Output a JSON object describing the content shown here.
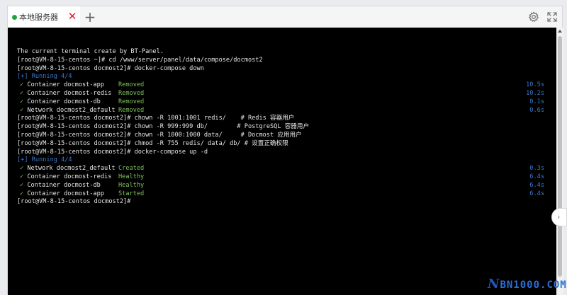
{
  "tab": {
    "label": "本地服务器",
    "close_symbol": "✕",
    "new_tab_symbol": "+"
  },
  "icons": {
    "status": "status-dot-icon",
    "close": "close-icon",
    "new_tab": "plus-icon",
    "settings": "gear-icon",
    "fullscreen": "fullscreen-icon"
  },
  "colors": {
    "terminal_bg": "#000000",
    "text": "#e6e6e6",
    "blue": "#3b78c8",
    "green": "#7fc35a",
    "status_dot": "#20a53a",
    "close": "#e0202a"
  },
  "terminal": {
    "welcome": "The current terminal create by BT-Panel.",
    "cmd1": "[root@VM-8-15-centos ~]# cd /www/server/panel/data/compose/docmost2",
    "cmd2": "[root@VM-8-15-centos docmost2]# docker-compose down",
    "running1": "[+] Running 4/4",
    "down_rows": [
      {
        "check": "✓",
        "name": "Container docmost-app",
        "status": "Removed",
        "time": "10.5s"
      },
      {
        "check": "✓",
        "name": "Container docmost-redis",
        "status": "Removed",
        "time": "10.2s"
      },
      {
        "check": "✓",
        "name": "Container docmost-db",
        "status": "Removed",
        "time": "0.1s"
      },
      {
        "check": "✓",
        "name": "Network docmost2_default",
        "status": "Removed",
        "time": "0.6s"
      }
    ],
    "cmd3": "[root@VM-8-15-centos docmost2]# chown -R 1001:1001 redis/    # Redis 容器用户",
    "cmd4": "[root@VM-8-15-centos docmost2]# chown -R 999:999 db/        # PostgreSQL 容器用户",
    "cmd5": "[root@VM-8-15-centos docmost2]# chown -R 1000:1000 data/     # Docmost 应用用户",
    "cmd6": "[root@VM-8-15-centos docmost2]# chmod -R 755 redis/ data/ db/ # 设置正确权限",
    "cmd7": "[root@VM-8-15-centos docmost2]# docker-compose up -d",
    "running2": "[+] Running 4/4",
    "up_rows": [
      {
        "check": "✓",
        "name": "Network docmost2_default",
        "status": "Created",
        "time": "0.3s"
      },
      {
        "check": "✓",
        "name": "Container docmost-redis",
        "status": "Healthy",
        "time": "6.4s"
      },
      {
        "check": "✓",
        "name": "Container docmost-db",
        "status": "Healthy",
        "time": "6.4s"
      },
      {
        "check": "✓",
        "name": "Container docmost-app",
        "status": "Started",
        "time": "6.4s"
      }
    ],
    "prompt": "[root@VM-8-15-centos docmost2]#"
  },
  "side_handle_symbol": "›",
  "watermark": {
    "prefix": "N",
    "rest": "BN1000.COM"
  }
}
